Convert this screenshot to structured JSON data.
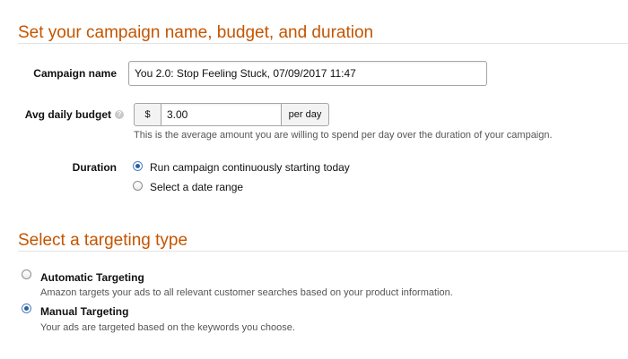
{
  "campaign_section": {
    "title": "Set your campaign name, budget, and duration",
    "campaign_name_label": "Campaign name",
    "campaign_name_value": "You 2.0: Stop Feeling Stuck, 07/09/2017 11:47",
    "budget_label": "Avg daily budget",
    "help_icon": "?",
    "currency_symbol": "$",
    "budget_value": "3.00",
    "per_day_label": "per day",
    "budget_hint": "This is the average amount you are willing to spend per day over the duration of your campaign.",
    "duration_label": "Duration",
    "duration_options": [
      {
        "label": "Run campaign continuously starting today",
        "selected": true
      },
      {
        "label": "Select a date range",
        "selected": false
      }
    ]
  },
  "targeting_section": {
    "title": "Select a targeting type",
    "options": [
      {
        "label": "Automatic Targeting",
        "description": "Amazon targets your ads to all relevant customer searches based on your product information.",
        "selected": false
      },
      {
        "label": "Manual Targeting",
        "description": "Your ads are targeted based on the keywords you choose.",
        "selected": true
      }
    ]
  },
  "colors": {
    "section_title": "#c45500",
    "radio_selected": "#2c5f9e"
  },
  "icons": {
    "help": "help-icon",
    "radio": "radio-icon"
  }
}
